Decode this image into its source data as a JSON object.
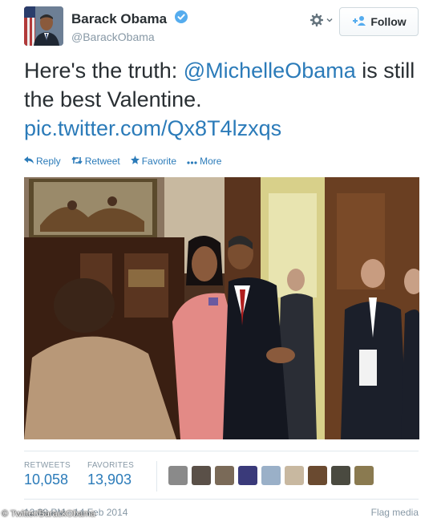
{
  "author": {
    "display_name": "Barack Obama",
    "handle": "@BarackObama",
    "avatar_icon": "profile-photo",
    "verified_icon": "verified-badge-icon",
    "verified_color": "#55acee"
  },
  "header": {
    "settings_icon": "gear-icon",
    "follow_label": "Follow",
    "follow_icon": "add-user-icon"
  },
  "tweet": {
    "text_before": "Here's the truth: ",
    "mention": "@MichelleObama",
    "text_after": " is still the best Valentine.",
    "pic_link": "pic.twitter.com/Qx8T4lzxqs"
  },
  "actions": {
    "reply": "Reply",
    "retweet": "Retweet",
    "favorite": "Favorite",
    "more": "More"
  },
  "stats": {
    "retweets_label": "RETWEETS",
    "retweets_value": "10,058",
    "favorites_label": "FAVORITES",
    "favorites_value": "13,903"
  },
  "footer": {
    "timestamp": "12:09 PM - 14 Feb 2014",
    "flag_label": "Flag media",
    "watermark": "© Twitter/BarackObama"
  },
  "colors": {
    "link": "#2b7bb9",
    "text": "#292f33",
    "muted": "#8899a6"
  }
}
